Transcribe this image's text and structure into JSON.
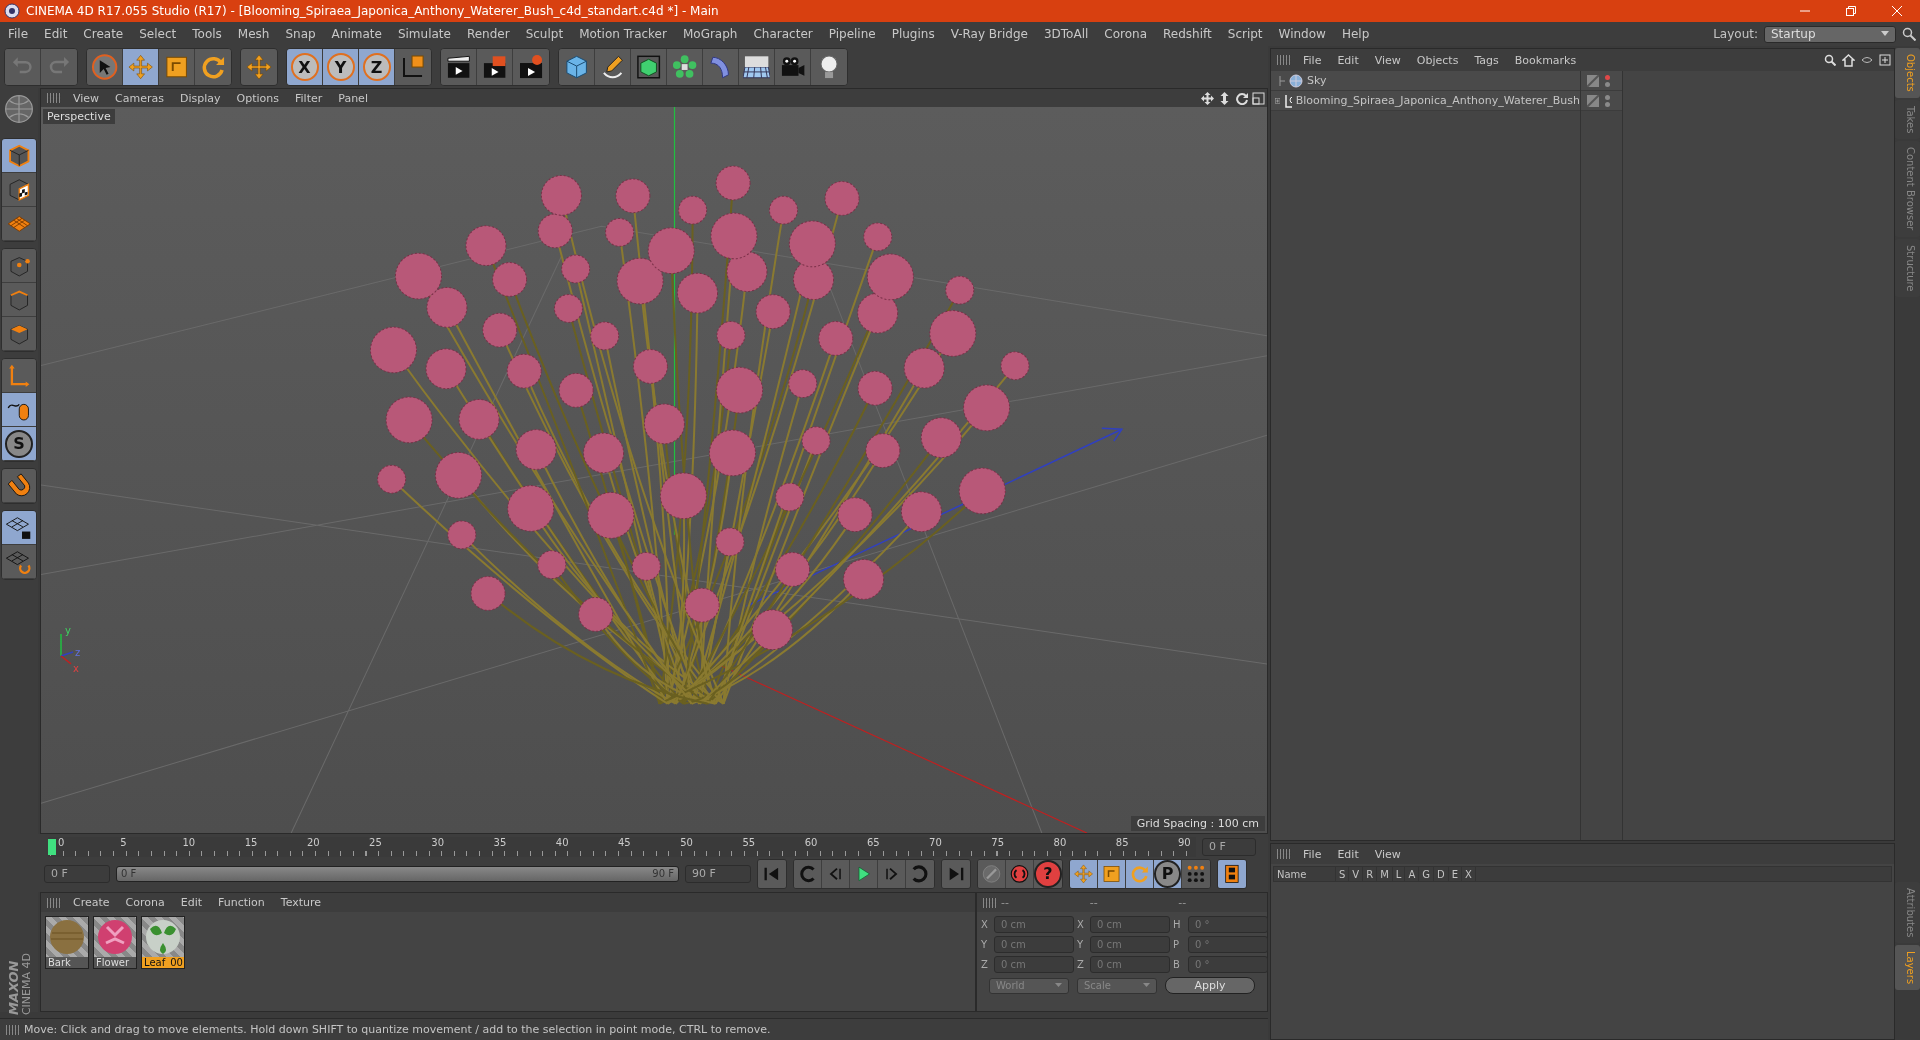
{
  "window": {
    "title": "CINEMA 4D R17.055 Studio (R17) - [Blooming_Spiraea_Japonica_Anthony_Waterer_Bush_c4d_standart.c4d *] - Main"
  },
  "menu": [
    "File",
    "Edit",
    "Create",
    "Select",
    "Tools",
    "Mesh",
    "Snap",
    "Animate",
    "Simulate",
    "Render",
    "Sculpt",
    "Motion Tracker",
    "MoGraph",
    "Character",
    "Pipeline",
    "Plugins",
    "V-Ray Bridge",
    "3DToAll",
    "Corona",
    "Redshift",
    "Script",
    "Window",
    "Help"
  ],
  "layout": {
    "label": "Layout:",
    "value": "Startup"
  },
  "toolbar": [
    [
      {
        "kind": "undo",
        "selected": false
      },
      {
        "kind": "redo",
        "selected": false
      }
    ],
    [
      {
        "kind": "pointer",
        "selected": false
      },
      {
        "kind": "move",
        "selected": true
      },
      {
        "kind": "scale",
        "selected": false
      },
      {
        "kind": "rotate",
        "selected": false
      }
    ],
    [
      {
        "kind": "move",
        "selected": false
      }
    ],
    [
      {
        "kind": "axis-lock",
        "label": "X",
        "selected": true
      },
      {
        "kind": "axis-lock",
        "label": "Y",
        "selected": true
      },
      {
        "kind": "axis-lock",
        "label": "Z",
        "selected": true
      },
      {
        "kind": "coordinate-system",
        "selected": false
      }
    ],
    [
      {
        "kind": "clapperboard",
        "selected": false
      },
      {
        "kind": "clapperboard-frame",
        "selected": false
      },
      {
        "kind": "clapperboard-gear",
        "selected": false
      }
    ],
    [
      {
        "kind": "cube",
        "selected": false
      },
      {
        "kind": "pen",
        "selected": false
      },
      {
        "kind": "green-cube",
        "selected": false
      },
      {
        "kind": "cloner",
        "selected": false
      },
      {
        "kind": "bend",
        "selected": false
      },
      {
        "kind": "floor",
        "selected": false
      },
      {
        "kind": "camera",
        "selected": false
      },
      {
        "kind": "light-bulb",
        "selected": false
      }
    ]
  ],
  "left_tools": [
    [
      {
        "kind": "cube-outline",
        "selected": true
      },
      {
        "kind": "checker-cube",
        "selected": false
      },
      {
        "kind": "grid-plane",
        "selected": false
      }
    ],
    [
      {
        "kind": "cube-points",
        "selected": false
      },
      {
        "kind": "cube-edge",
        "selected": false
      },
      {
        "kind": "cube-face",
        "selected": false
      }
    ],
    [
      {
        "kind": "axis",
        "selected": false
      },
      {
        "kind": "mouse",
        "selected": true
      },
      {
        "kind": "snap",
        "label": "S",
        "selected": true
      }
    ],
    [
      {
        "kind": "magnet",
        "selected": false
      }
    ],
    [
      {
        "kind": "locked-grid",
        "selected": true
      },
      {
        "kind": "grid-refresh",
        "selected": false
      }
    ]
  ],
  "viewport": {
    "menu": [
      "View",
      "Cameras",
      "Display",
      "Options",
      "Filter",
      "Panel"
    ],
    "camera": "Perspective",
    "grid_spacing": "Grid Spacing : 100 cm",
    "axis_gizmo": [
      "y",
      "z",
      "x"
    ]
  },
  "timeline": {
    "ruler_labels": [
      "0",
      "5",
      "10",
      "15",
      "20",
      "25",
      "30",
      "35",
      "40",
      "45",
      "50",
      "55",
      "60",
      "65",
      "70",
      "75",
      "80",
      "85",
      "90"
    ],
    "playhead": {
      "level": 0
    },
    "current_frame": "0 F",
    "start_field": "0 F",
    "range_slider": {
      "level": 1
    },
    "range_start": "0 F",
    "range_end": "90 F",
    "end_field": "90 F",
    "controls": [
      [
        {
          "kind": "first-frame",
          "selected": false
        }
      ],
      [
        {
          "kind": "previous-key",
          "selected": false
        },
        {
          "kind": "previous-frame",
          "selected": false
        },
        {
          "kind": "play",
          "selected": false
        },
        {
          "kind": "next-frame",
          "selected": false
        },
        {
          "kind": "next-key",
          "selected": false
        }
      ],
      [
        {
          "kind": "last-frame",
          "selected": false
        }
      ],
      [
        {
          "kind": "key-disabled",
          "selected": false
        },
        {
          "kind": "record",
          "selected": false
        },
        {
          "kind": "help",
          "label": "?",
          "selected": false
        }
      ],
      [
        {
          "kind": "move",
          "selected": true
        },
        {
          "kind": "scale",
          "selected": true
        },
        {
          "kind": "rotate",
          "selected": true
        },
        {
          "kind": "parameter",
          "label": "P",
          "selected": true
        },
        {
          "kind": "point-grid",
          "selected": false
        }
      ],
      [
        {
          "kind": "film-strip",
          "selected": true
        }
      ]
    ]
  },
  "materials": {
    "menu": [
      "Create",
      "Corona",
      "Edit",
      "Function",
      "Texture"
    ],
    "items": [
      {
        "name": "Bark",
        "kind": "wood",
        "selected": false
      },
      {
        "name": "Flower_",
        "kind": "flower",
        "selected": false
      },
      {
        "name": "Leaf_00",
        "kind": "leaf",
        "selected": true
      }
    ]
  },
  "logo": {
    "brand": "MAXON",
    "product": "CINEMA 4D"
  },
  "coordinates": {
    "headers": [
      "--",
      "--",
      "--"
    ],
    "rows": [
      {
        "pos_axis": "X",
        "pos": "0 cm",
        "size_axis": "X",
        "size": "0 cm",
        "rot_axis": "H",
        "rot": "0 °"
      },
      {
        "pos_axis": "Y",
        "pos": "0 cm",
        "size_axis": "Y",
        "size": "0 cm",
        "rot_axis": "P",
        "rot": "0 °"
      },
      {
        "pos_axis": "Z",
        "pos": "0 cm",
        "size_axis": "Z",
        "size": "0 cm",
        "rot_axis": "B",
        "rot": "0 °"
      }
    ],
    "dropdowns": [
      "World",
      "Scale"
    ],
    "apply": "Apply"
  },
  "objects": {
    "menu": [
      "File",
      "Edit",
      "View",
      "Objects",
      "Tags",
      "Bookmarks"
    ],
    "items": [
      {
        "name": "Sky",
        "kind": "sky",
        "expandable": false,
        "color": "#e04848"
      },
      {
        "name": "Blooming_Spiraea_Japonica_Anthony_Waterer_Bush",
        "kind": "null",
        "expandable": true,
        "color": "#8a8a8a"
      }
    ]
  },
  "layers": {
    "menu": [
      "File",
      "Edit",
      "View"
    ],
    "columns": [
      "Name",
      "S",
      "V",
      "R",
      "M",
      "L",
      "A",
      "G",
      "D",
      "E",
      "X"
    ]
  },
  "side_tabs_top": [
    {
      "label": "Objects",
      "selected": true
    },
    {
      "label": "Takes",
      "selected": false
    },
    {
      "label": "Content Browser",
      "selected": false
    },
    {
      "label": "Structure",
      "selected": false
    }
  ],
  "side_tabs_bottom": [
    {
      "label": "Attributes",
      "selected": false
    },
    {
      "label": "Layers",
      "selected": true
    }
  ],
  "status_bar": "Move: Click and drag to move elements. Hold down SHIFT to quantize movement / add to the selection in point mode, CTRL to remove."
}
